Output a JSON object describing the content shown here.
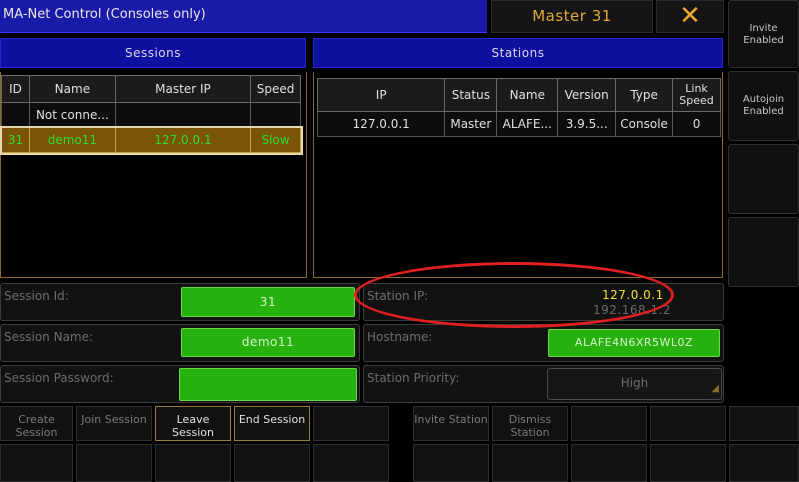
{
  "window": {
    "title": "MA-Net Control (Consoles only)",
    "master_label": "Master 31",
    "close_symbol": "✕"
  },
  "sessions": {
    "header": "Sessions",
    "columns": [
      "ID",
      "Name",
      "Master IP",
      "Speed"
    ],
    "rows": [
      {
        "id": "",
        "name": "Not conne...",
        "master_ip": "",
        "speed": ""
      },
      {
        "id": "31",
        "name": "demo11",
        "master_ip": "127.0.0.1",
        "speed": "Slow"
      }
    ]
  },
  "stations": {
    "header": "Stations",
    "columns": [
      "IP",
      "Status",
      "Name",
      "Version",
      "Type",
      "Link Speed"
    ],
    "rows": [
      {
        "ip": "127.0.0.1",
        "status": "Master",
        "name": "ALAFE...",
        "version": "3.9.5...",
        "type": "Console",
        "link_speed": "0"
      }
    ]
  },
  "form": {
    "session_id": {
      "label": "Session Id:",
      "value": "31"
    },
    "session_name": {
      "label": "Session Name:",
      "value": "demo11"
    },
    "session_password": {
      "label": "Session Password:",
      "value": ""
    },
    "station_ip": {
      "label": "Station IP:",
      "value": "127.0.0.1",
      "secondary": "192.168.1.2"
    },
    "hostname": {
      "label": "Hostname:",
      "value": "ALAFE4N6XR5WL0Z"
    },
    "station_priority": {
      "label": "Station Priority:",
      "value": "High"
    }
  },
  "buttons": {
    "create_session": "Create Session",
    "join_session": "Join Session",
    "leave_session": "Leave Session",
    "end_session": "End Session",
    "invite_station": "Invite Station",
    "dismiss_station": "Dismiss Station"
  },
  "side": {
    "invite_enabled": "Invite Enabled",
    "autojoin_enabled": "Autojoin Enabled"
  },
  "colors": {
    "title_bar": "#1a1aa8",
    "master_text": "#e3a83a",
    "green_field": "#27b10f",
    "selected_row": "#7a5408",
    "annotation_ellipse": "#e02020"
  }
}
